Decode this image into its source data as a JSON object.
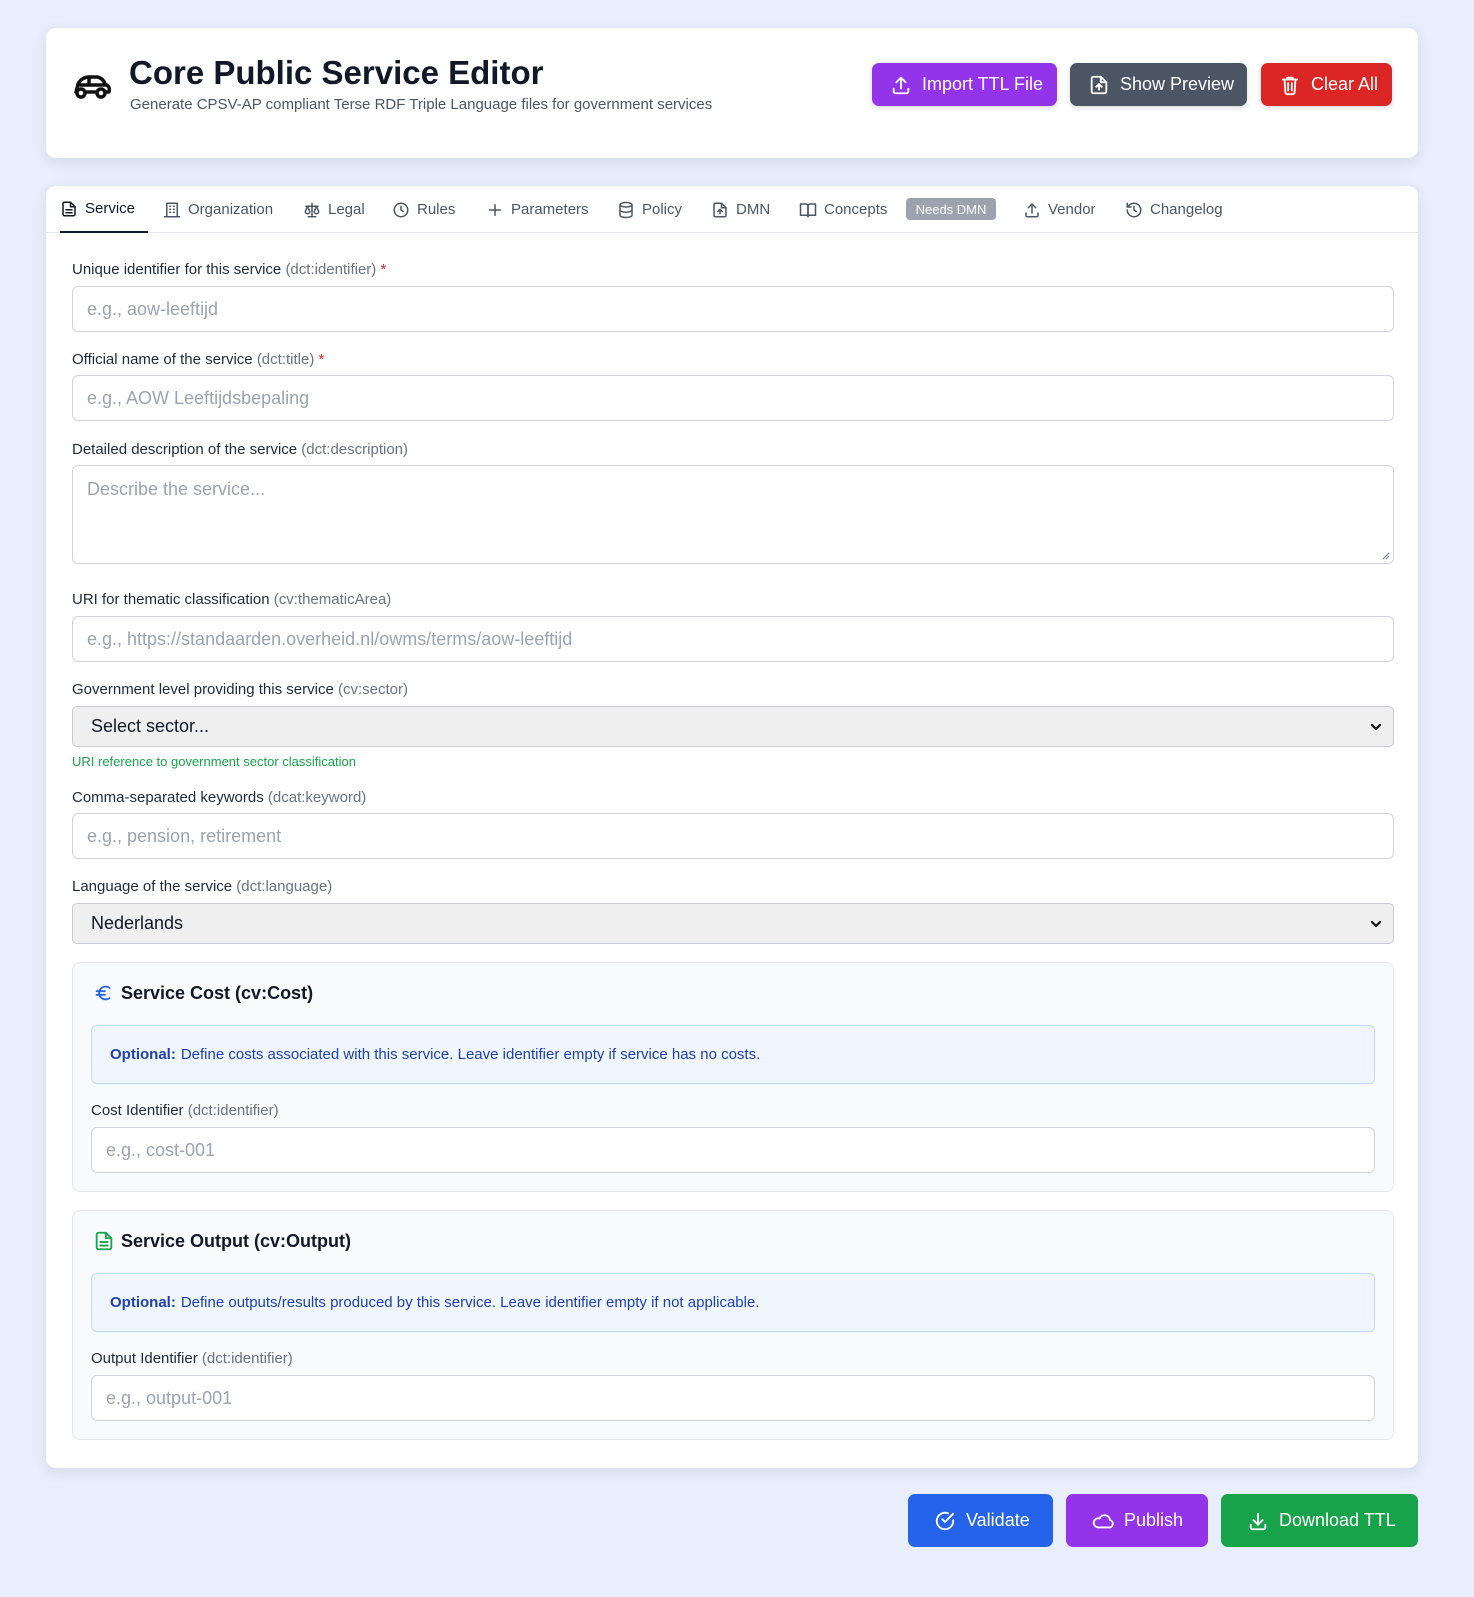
{
  "header": {
    "title": "Core Public Service Editor",
    "subtitle": "Generate CPSV-AP compliant Terse RDF Triple Language files for government services",
    "import_label": "Import TTL File",
    "preview_label": "Show Preview",
    "clear_label": "Clear All"
  },
  "tabs": [
    {
      "label": "Service",
      "icon": "document-icon",
      "active": true
    },
    {
      "label": "Organization",
      "icon": "building-icon"
    },
    {
      "label": "Legal",
      "icon": "scale-icon"
    },
    {
      "label": "Rules",
      "icon": "clock-icon"
    },
    {
      "label": "Parameters",
      "icon": "plus-icon"
    },
    {
      "label": "Policy",
      "icon": "database-icon"
    },
    {
      "label": "DMN",
      "icon": "file-upload-icon"
    },
    {
      "label": "Concepts",
      "icon": "book-icon"
    },
    {
      "label": "Vendor",
      "icon": "upload-icon"
    },
    {
      "label": "Changelog",
      "icon": "history-icon"
    }
  ],
  "badge": "Needs DMN",
  "fields": {
    "identifier": {
      "label": "Unique identifier for this service",
      "term": "(dct:identifier)",
      "required": "*",
      "placeholder": "e.g., aow-leeftijd"
    },
    "title": {
      "label": "Official name of the service",
      "term": "(dct:title)",
      "required": "*",
      "placeholder": "e.g., AOW Leeftijdsbepaling"
    },
    "description": {
      "label": "Detailed description of the service",
      "term": "(dct:description)",
      "placeholder": "Describe the service..."
    },
    "thematic": {
      "label": "URI for thematic classification",
      "term": "(cv:thematicArea)",
      "placeholder": "e.g., https://standaarden.overheid.nl/owms/terms/aow-leeftijd"
    },
    "sector": {
      "label": "Government level providing this service",
      "term": "(cv:sector)",
      "value": "Select sector...",
      "hint": "URI reference to government sector classification"
    },
    "keywords": {
      "label": "Comma-separated keywords",
      "term": "(dcat:keyword)",
      "placeholder": "e.g., pension, retirement"
    },
    "language": {
      "label": "Language of the service",
      "term": "(dct:language)",
      "value": "Nederlands"
    }
  },
  "cost": {
    "title": "Service Cost (cv:Cost)",
    "info_strong": "Optional:",
    "info_text": "Define costs associated with this service. Leave identifier empty if service has no costs.",
    "field_label": "Cost Identifier",
    "field_term": "(dct:identifier)",
    "placeholder": "e.g., cost-001"
  },
  "output": {
    "title": "Service Output (cv:Output)",
    "info_strong": "Optional:",
    "info_text": "Define outputs/results produced by this service. Leave identifier empty if not applicable.",
    "field_label": "Output Identifier",
    "field_term": "(dct:identifier)",
    "placeholder": "e.g., output-001"
  },
  "footer": {
    "validate_label": "Validate",
    "publish_label": "Publish",
    "download_label": "Download TTL"
  },
  "colors": {
    "purple": "#9333ea",
    "gray": "#4b5563",
    "red": "#dc2626",
    "blue": "#2563eb",
    "green": "#16a34a"
  }
}
